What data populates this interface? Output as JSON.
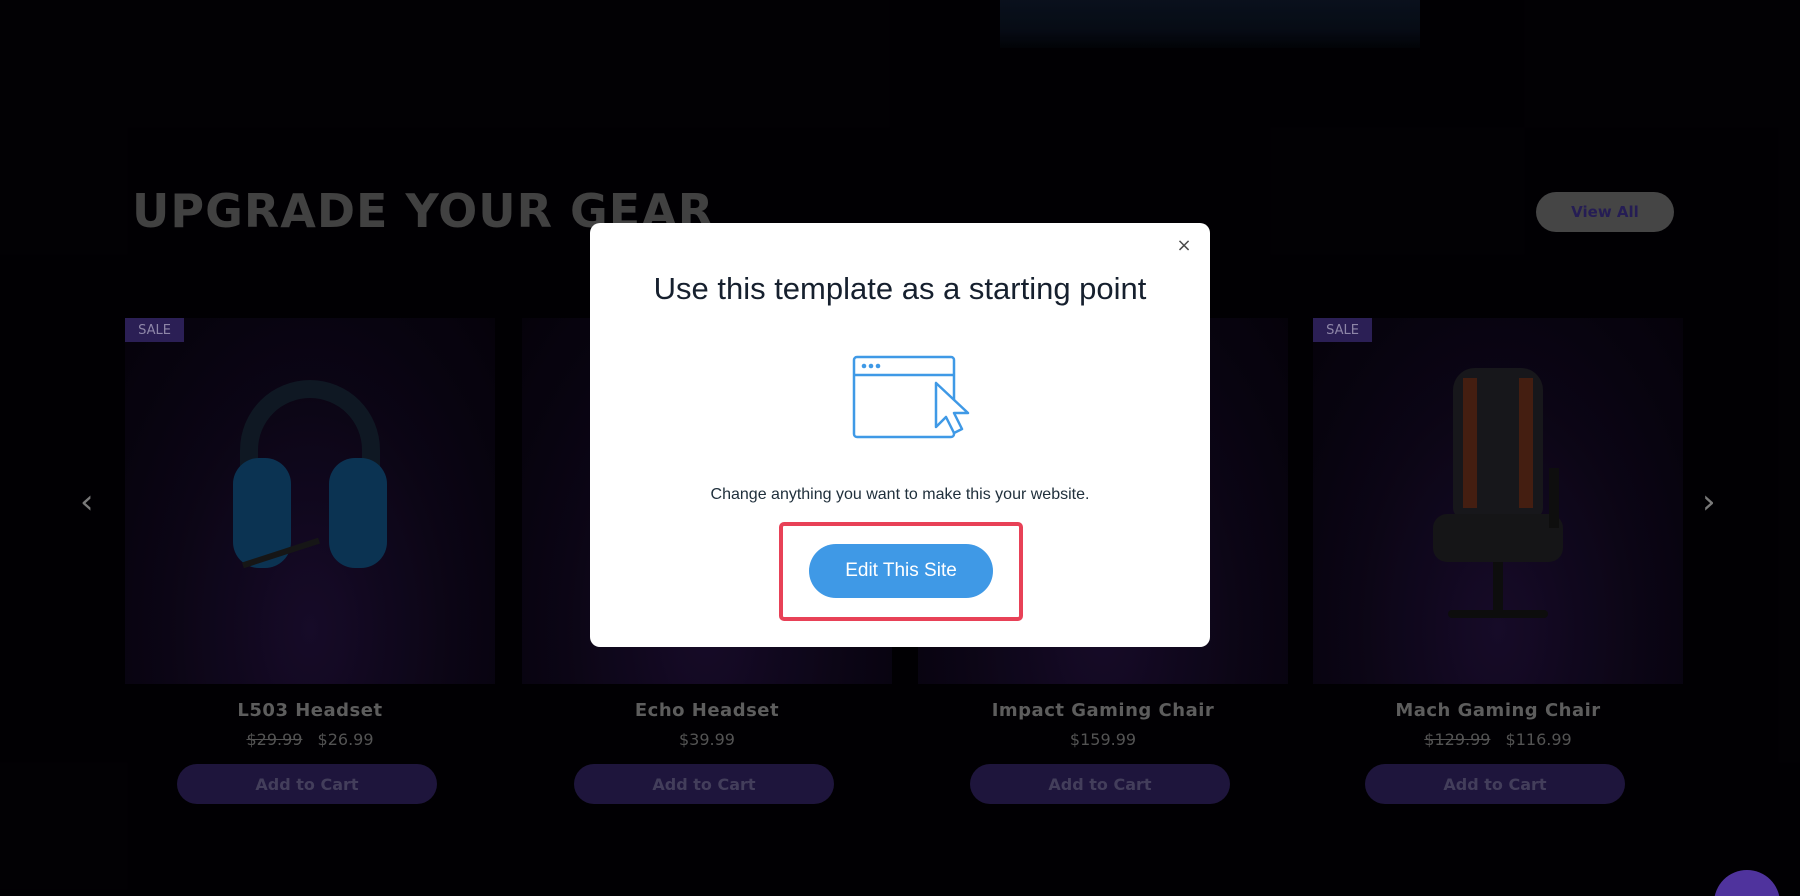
{
  "section": {
    "title": "UPGRADE YOUR GEAR",
    "view_all_label": "View All"
  },
  "carousel": {
    "prev_glyph": "‹",
    "next_glyph": "›"
  },
  "products": [
    {
      "name": "L503 Headset",
      "badge": "SALE",
      "old_price": "$29.99",
      "price": "$26.99",
      "button": "Add to Cart"
    },
    {
      "name": "Echo Headset",
      "badge": "",
      "old_price": "",
      "price": "$39.99",
      "button": "Add to Cart"
    },
    {
      "name": "Impact Gaming Chair",
      "badge": "",
      "old_price": "",
      "price": "$159.99",
      "button": "Add to Cart"
    },
    {
      "name": "Mach Gaming Chair",
      "badge": "SALE",
      "old_price": "$129.99",
      "price": "$116.99",
      "button": "Add to Cart"
    }
  ],
  "modal": {
    "close_glyph": "×",
    "title": "Use this template as a starting point",
    "illustration_icon": "browser-window-cursor-icon",
    "description": "Change anything you want to make this your website.",
    "primary_button": "Edit This Site"
  },
  "colors": {
    "primary_blue": "#3f99e6",
    "highlight_red": "#e84157",
    "brand_purple": "#2b1f55"
  }
}
